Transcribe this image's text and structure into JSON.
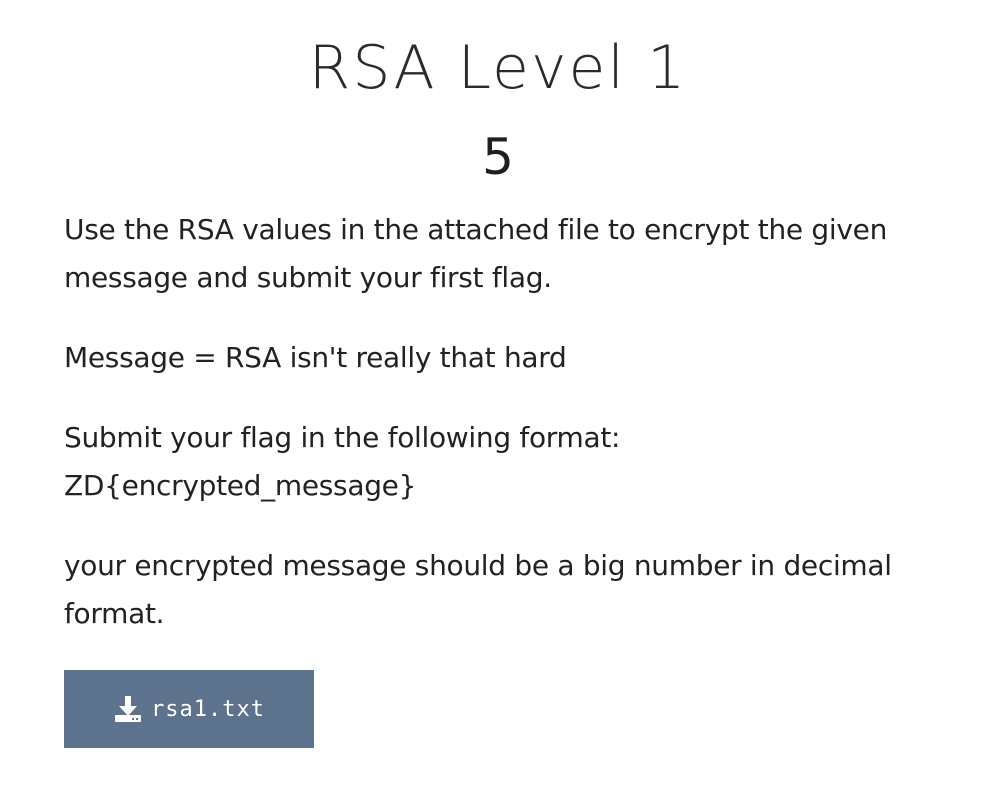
{
  "challenge": {
    "title": "RSA Level 1",
    "points": "5"
  },
  "description": {
    "paragraph_1": "Use the RSA values in the attached file to encrypt the given message and submit your first flag.",
    "paragraph_2": "Message = RSA isn't really that hard",
    "paragraph_3_line_1": "Submit your flag in the following format:",
    "paragraph_3_line_2": "ZD{encrypted_message}",
    "paragraph_4": "your encrypted message should be a big number in decimal format."
  },
  "attachment": {
    "filename": "rsa1.txt",
    "icon": "download-icon",
    "button_color": "#5d728c"
  }
}
